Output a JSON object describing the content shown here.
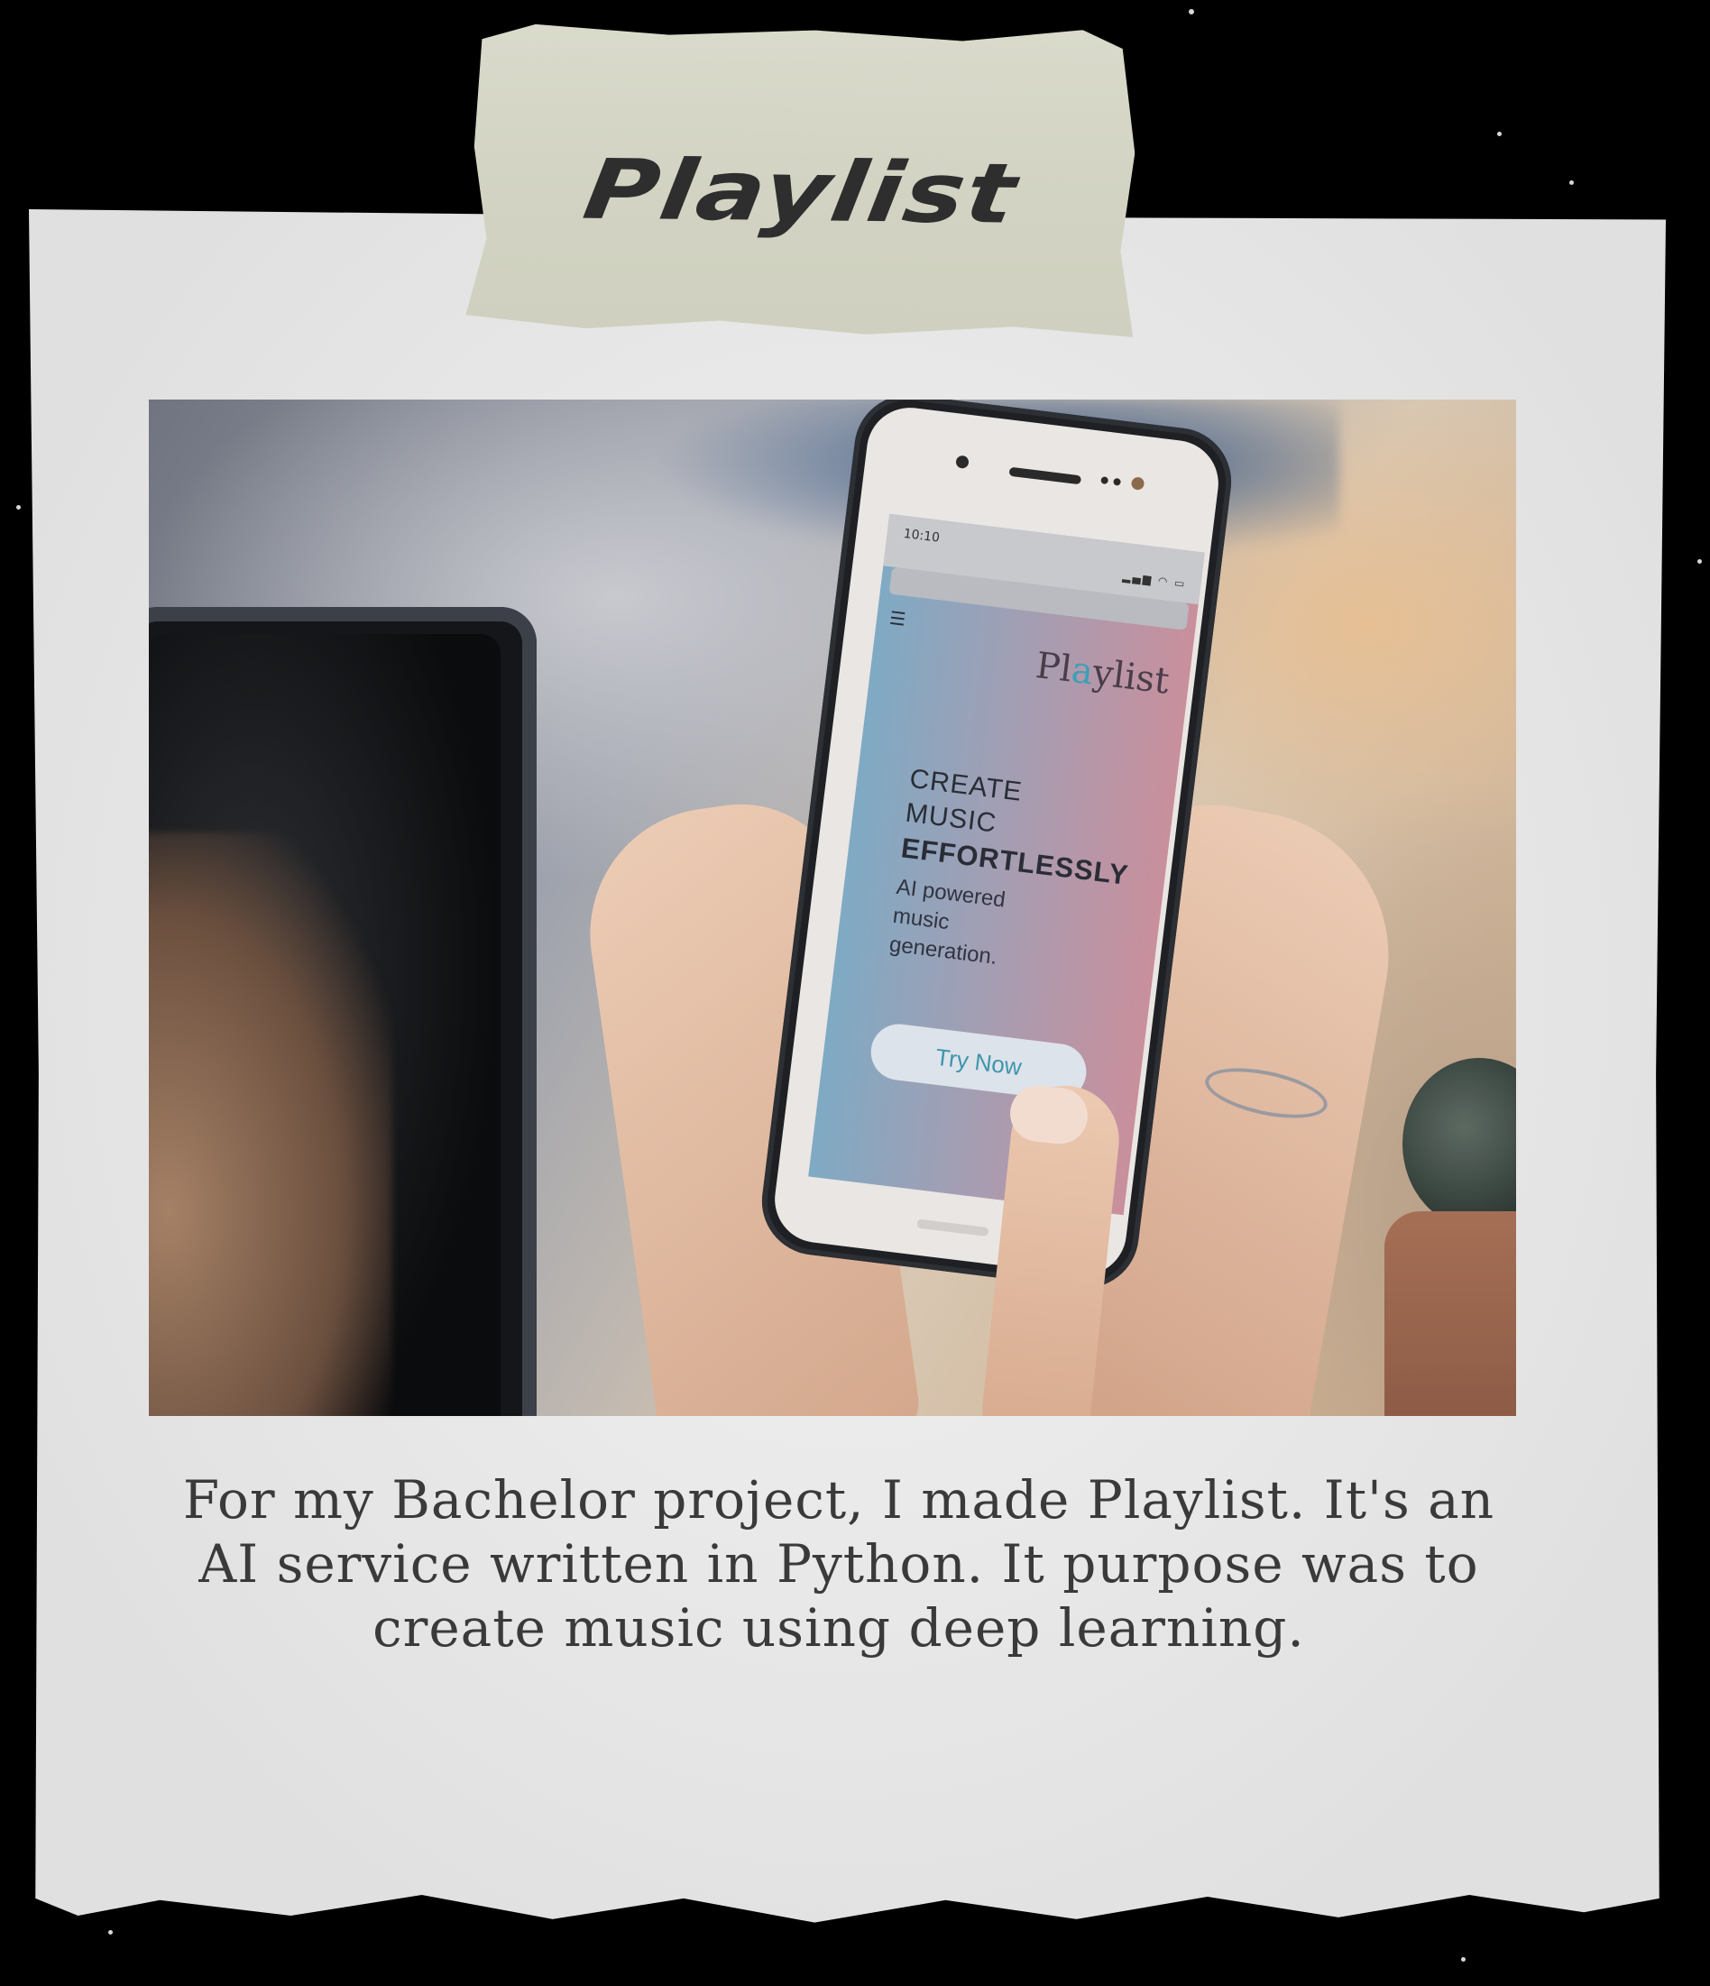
{
  "card": {
    "title": "Playlist",
    "caption": "For my Bachelor project, I made Playlist. It's an AI service written in Python. It purpose was to create music using deep learning."
  },
  "phone_screen": {
    "time": "10:10",
    "status_icons": "▂▄▆ ◠ ▭",
    "menu_icon": "menu-icon",
    "brand_start": "Pl",
    "brand_accent": "a",
    "brand_end": "ylist",
    "headline_line1": "CREATE",
    "headline_line2": "MUSIC",
    "headline_strong": "EFFORTLESSLY",
    "subtitle": "AI powered music generation.",
    "cta_label": "Try Now"
  },
  "colors": {
    "tape": "#d3d4c3",
    "paper": "#ececec",
    "screen_left": "#7faac4",
    "screen_right": "#c98f9c",
    "cta_text": "#3e95ad"
  }
}
